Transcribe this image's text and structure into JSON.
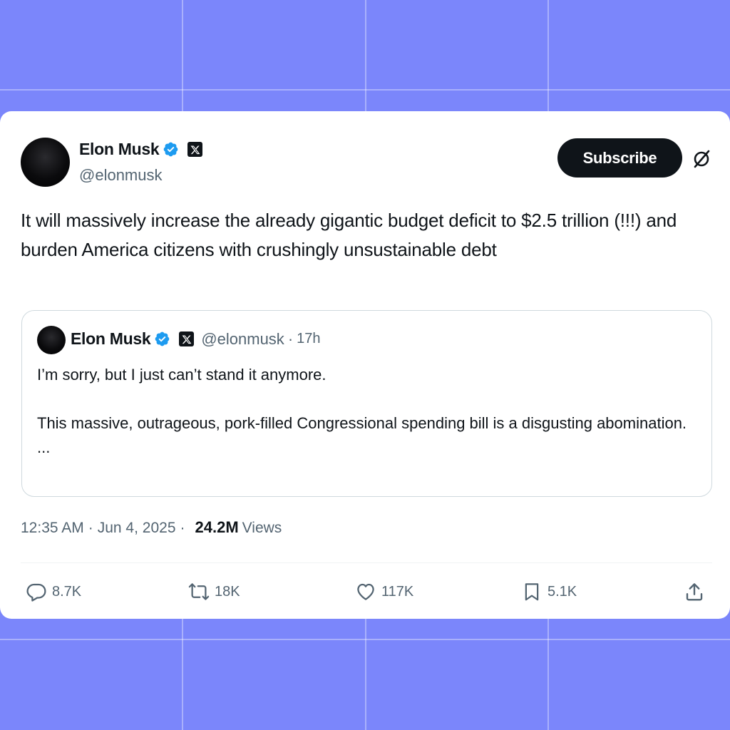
{
  "author": {
    "name": "Elon Musk",
    "handle": "@elonmusk",
    "verified_icon": "verified-badge-icon",
    "affiliation_icon": "x-logo-icon"
  },
  "header": {
    "subscribe_label": "Subscribe",
    "grok_icon": "grok-icon"
  },
  "tweet": {
    "text": "It will massively increase the already gigantic budget deficit to $2.5 trillion (!!!) and burden America citizens with crushingly unsustainable debt"
  },
  "quote": {
    "name": "Elon Musk",
    "handle": "@elonmusk",
    "separator": "·",
    "time": "17h",
    "line1": "I’m sorry, but I just can’t stand it anymore.",
    "line2": "This massive, outrageous, pork-filled Congressional spending bill is a disgusting abomination.",
    "ellipsis": "..."
  },
  "meta": {
    "time": "12:35 AM",
    "date": "Jun 4, 2025",
    "separator": "·",
    "views_count": "24.2M",
    "views_label": "Views"
  },
  "actions": {
    "replies": "8.7K",
    "reposts": "18K",
    "likes": "117K",
    "bookmarks": "5.1K"
  },
  "colors": {
    "background": "#7b86fb",
    "card": "#ffffff",
    "verified": "#1d9bf0",
    "text_primary": "#0f1419",
    "text_secondary": "#536471"
  }
}
